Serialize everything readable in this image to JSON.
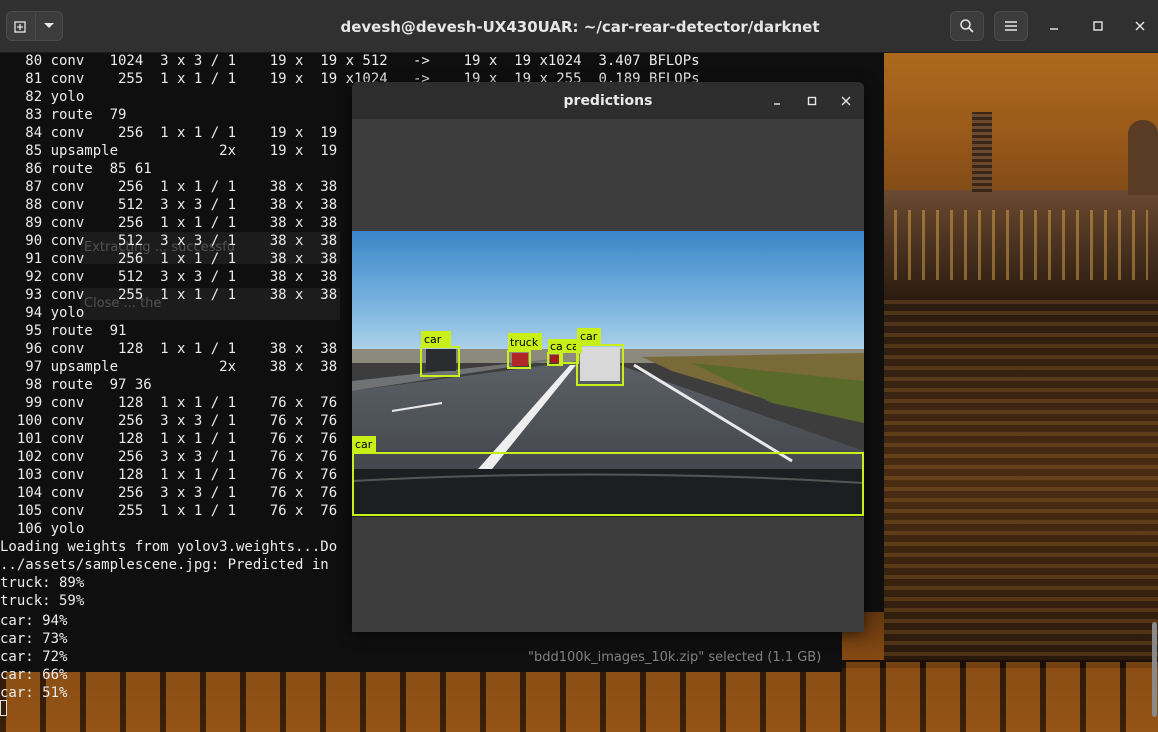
{
  "terminal": {
    "title": "devesh@devesh-UX430UAR: ~/car-rear-detector/darknet",
    "lines": [
      "   80 conv   1024  3 x 3 / 1    19 x  19 x 512   ->    19 x  19 x1024  3.407 BFLOPs",
      "   81 conv    255  1 x 1 / 1    19 x  19 x1024   ->    19 x  19 x 255  0.189 BFLOPs",
      "   82 yolo",
      "   83 route  79",
      "   84 conv    256  1 x 1 / 1    19 x  19",
      "   85 upsample            2x    19 x  19",
      "   86 route  85 61",
      "   87 conv    256  1 x 1 / 1    38 x  38",
      "   88 conv    512  3 x 3 / 1    38 x  38",
      "   89 conv    256  1 x 1 / 1    38 x  38",
      "   90 conv    512  3 x 3 / 1    38 x  38",
      "   91 conv    256  1 x 1 / 1    38 x  38",
      "   92 conv    512  3 x 3 / 1    38 x  38",
      "   93 conv    255  1 x 1 / 1    38 x  38",
      "   94 yolo",
      "   95 route  91",
      "   96 conv    128  1 x 1 / 1    38 x  38",
      "   97 upsample            2x    38 x  38",
      "   98 route  97 36",
      "   99 conv    128  1 x 1 / 1    76 x  76",
      "  100 conv    256  3 x 3 / 1    76 x  76",
      "  101 conv    128  1 x 1 / 1    76 x  76",
      "  102 conv    256  3 x 3 / 1    76 x  76",
      "  103 conv    128  1 x 1 / 1    76 x  76",
      "  104 conv    256  3 x 3 / 1    76 x  76",
      "  105 conv    255  1 x 1 / 1    76 x  76",
      "  106 yolo",
      "Loading weights from yolov3.weights...Do",
      "../assets/samplescene.jpg: Predicted in",
      "truck: 89%",
      "truck: 59%"
    ],
    "bottom_lines": [
      "car: 94%",
      "car: 73%",
      "car: 72%",
      "car: 66%",
      "car: 51%"
    ],
    "ghost_rows": [
      "Extracting ... successfu",
      "Close ... the"
    ]
  },
  "file_manager": {
    "status": "\"bdd100k_images_10k.zip\" selected  (1.1 GB)"
  },
  "predictions_window": {
    "title": "predictions",
    "labels": {
      "car1": "car",
      "car2": "car",
      "car3": "car",
      "truck": "truck",
      "car_small_a": "ca",
      "car_small_b": "ca"
    }
  },
  "colors": {
    "bbox": "#c8f018",
    "terminal_bg": "#0f0f0f",
    "header_bg": "#303030"
  }
}
